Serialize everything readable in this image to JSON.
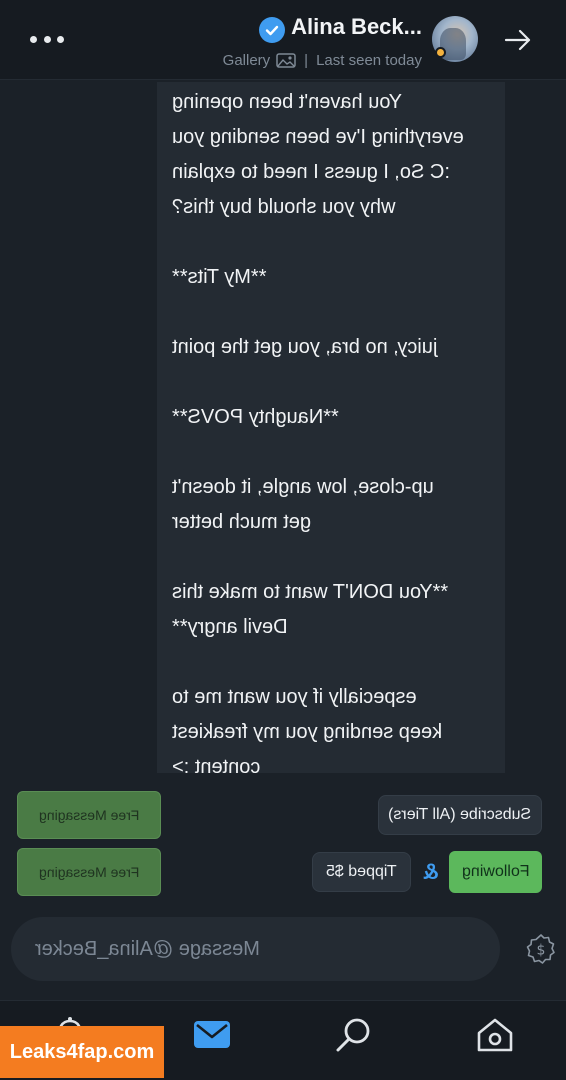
{
  "header": {
    "contact_name": "Alina Beck...",
    "last_seen": "Last seen today",
    "separator": "|",
    "gallery_label": "Gallery"
  },
  "message": {
    "text": "You haven't been opening\neverything I've been sending you\n:C So, I guess I need to explain\nwhy you should buy this?\n\n**My Tits**\n\njuicy, no bra, you get the point\n\n**Naughty POVS**\n\nup-close, low angle, it doesn't\nget much better\n\n**You DON'T want to make this\nDevil angry**\n\nespecially if you want me to\nkeep sending you my freakiest\ncontent :>"
  },
  "actions": {
    "subscribe_label": "Subscribe (All Tiers)",
    "free_messaging_label": "Free Messaging",
    "following_label": "Following",
    "ampersand": "&",
    "tipped_label": "Tipped $5"
  },
  "composer": {
    "placeholder": "Message @Alina_Becker"
  },
  "nav": {
    "items": [
      "home-icon",
      "search-icon",
      "messages-icon",
      "notifications-icon"
    ]
  },
  "watermark": {
    "text": "Leaks4fap.com"
  },
  "colors": {
    "background": "#1b2128",
    "bar": "#161b21",
    "bubble": "#242b33",
    "accent_blue": "#3f9cf0",
    "free_messaging_green": "#4a7b45",
    "following_green": "#5cb85c",
    "watermark_orange": "#f47c20"
  }
}
